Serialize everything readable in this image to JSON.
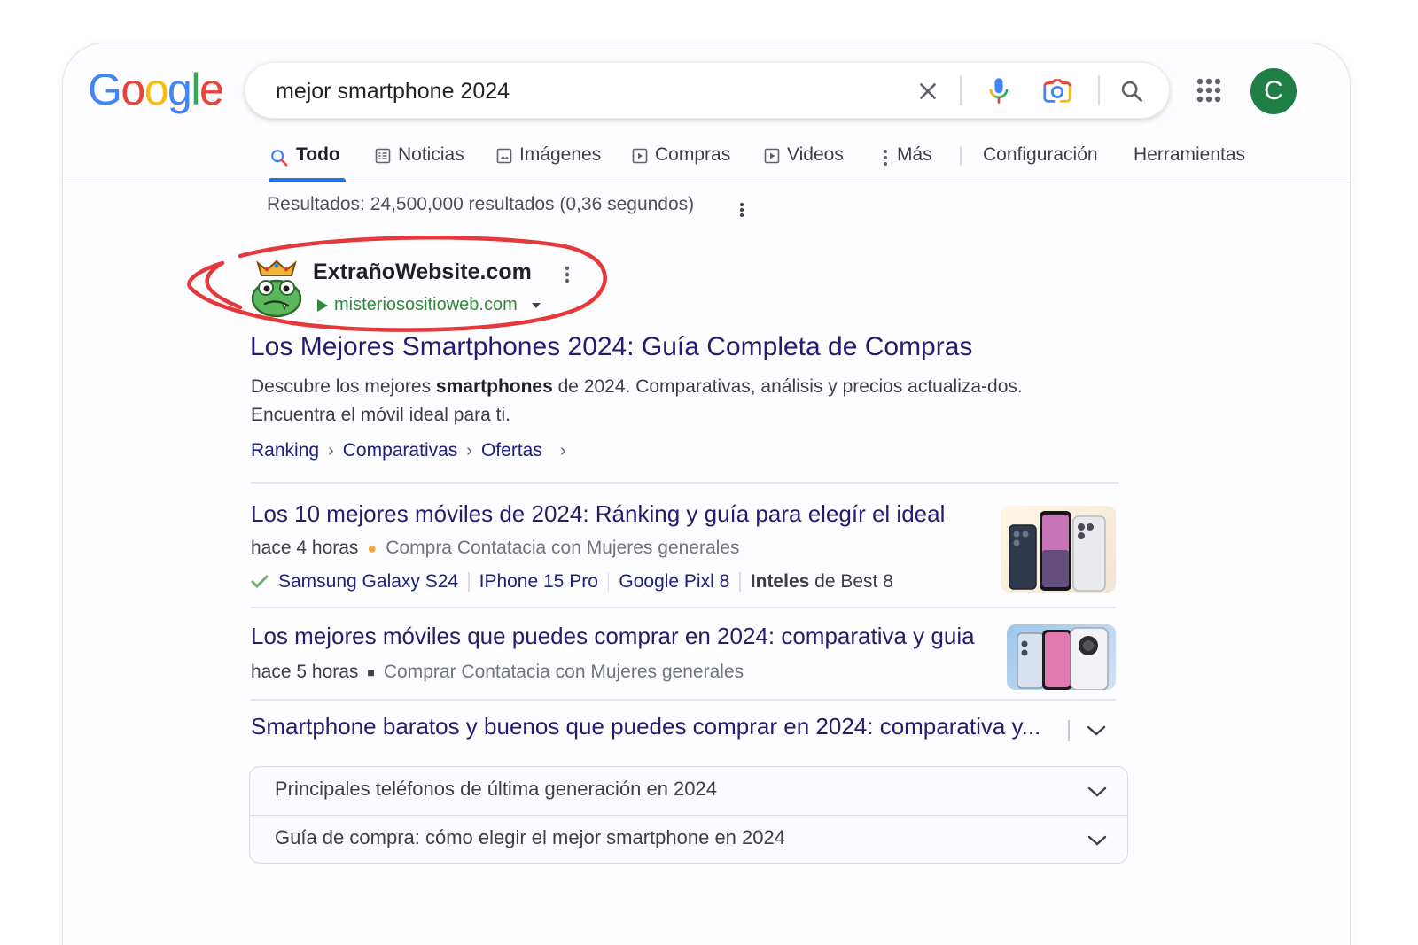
{
  "logo": {
    "text": "Google",
    "letters": [
      "G",
      "o",
      "o",
      "g",
      "l",
      "e"
    ],
    "colors": [
      "#4285f4",
      "#ea4335",
      "#fbbc05",
      "#4285f4",
      "#34a853",
      "#ea4335"
    ]
  },
  "search": {
    "query": "mejor smartphone 2024"
  },
  "icons": [
    "close-icon",
    "mic-icon",
    "camera-icon",
    "search-icon",
    "apps-icon"
  ],
  "user": {
    "avatar_letter": "C",
    "avatar_color": "#1e7e44"
  },
  "tabs": [
    {
      "label": "Todo",
      "active": true
    },
    {
      "label": "Noticias"
    },
    {
      "label": "Imágenes"
    },
    {
      "label": "Compras"
    },
    {
      "label": "Videos"
    },
    {
      "label": "Más"
    },
    {
      "label": "Configuración"
    },
    {
      "label": "Herramientas"
    }
  ],
  "stats": "Resultados: 24,500,000 resultados (0,36 segundos)",
  "result": {
    "site_name": "ExtrañoWebsite.com",
    "site_url": "misteriosositioweb.com",
    "title": "Los Mejores Smartphones 2024: Guía Completa de Compras",
    "snippet_1": "Descubre los mejores ",
    "snippet_bold": "smartphones",
    "snippet_2": " de 2024. Comparativas, análisis y precios actualiza-dos. Encuentra el móvil ideal para ti.",
    "breadcrumbs": [
      "Ranking",
      "Comparativas",
      "Ofertas"
    ]
  },
  "sub_results": [
    {
      "title": "Los 10 mejores móviles de 2024: Ránking y guía para elegír el ideal",
      "time": "hace 4 horas",
      "meta": "Compra Contatacia con Mujeres generales",
      "links": [
        "Samsung Galaxy S24",
        "IPhone 15 Pro",
        "Google Pixl 8"
      ],
      "links_tail_bold": "Inteles",
      "links_tail": " de Best 8"
    },
    {
      "title": "Los mejores móviles que puedes comprar en 2024: comparativa y guia",
      "time": "hace 5 horas",
      "meta": "Comprar  Contatacia con Mujeres generales"
    },
    {
      "title": "Smartphone baratos y buenos que puedes comprar en 2024: comparativa y..."
    }
  ],
  "accordion": [
    "Principales teléfonos de última generación en 2024",
    "Guía de compra: cómo elegir el mejor smartphone en 2024"
  ],
  "colors": {
    "annotation_red": "#e5383b",
    "link_purple": "#2a1a6e",
    "url_green": "#2e8b3a",
    "accent_blue": "#1a73e8"
  }
}
